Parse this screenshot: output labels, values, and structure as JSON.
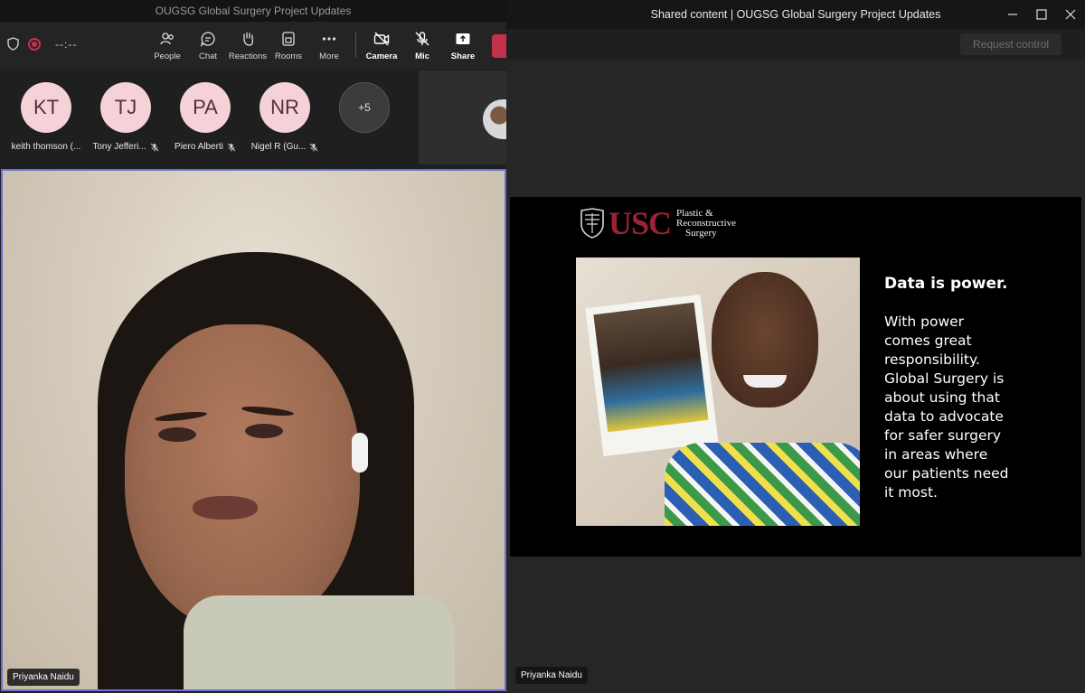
{
  "meeting_window": {
    "title": "OUGSG Global Surgery Project Updates",
    "timer": "--:--",
    "toolbar": {
      "people": "People",
      "chat": "Chat",
      "reactions": "Reactions",
      "rooms": "Rooms",
      "more": "More",
      "camera": "Camera",
      "mic": "Mic",
      "share": "Share"
    },
    "participants": [
      {
        "initials": "KT",
        "name": "keith thomson (..."
      },
      {
        "initials": "TJ",
        "name": "Tony Jefferi..."
      },
      {
        "initials": "PA",
        "name": "Piero Alberti"
      },
      {
        "initials": "NR",
        "name": "Nigel R (Gu..."
      }
    ],
    "overflow_count": "+5",
    "speaker_name": "Priyanka Naidu"
  },
  "shared_window": {
    "title": "Shared content | OUGSG Global Surgery Project Updates",
    "request_control": "Request control",
    "presenter_name": "Priyanka Naidu",
    "slide": {
      "logo_main": "USC",
      "logo_sub_line1": "Plastic &",
      "logo_sub_line2": "Reconstructive",
      "logo_sub_line3": "Surgery",
      "heading": "Data is power.",
      "body": "With power\ncomes great\nresponsibility.\nGlobal Surgery is\nabout using that\ndata to advocate\nfor safer surgery\nin areas where\nour patients need\nit most."
    }
  },
  "colors": {
    "accent_red": "#c4314b",
    "usc_cardinal": "#9d2235",
    "active_speaker_border": "#6a6fd0",
    "avatar_bg": "#f5d2d8"
  }
}
